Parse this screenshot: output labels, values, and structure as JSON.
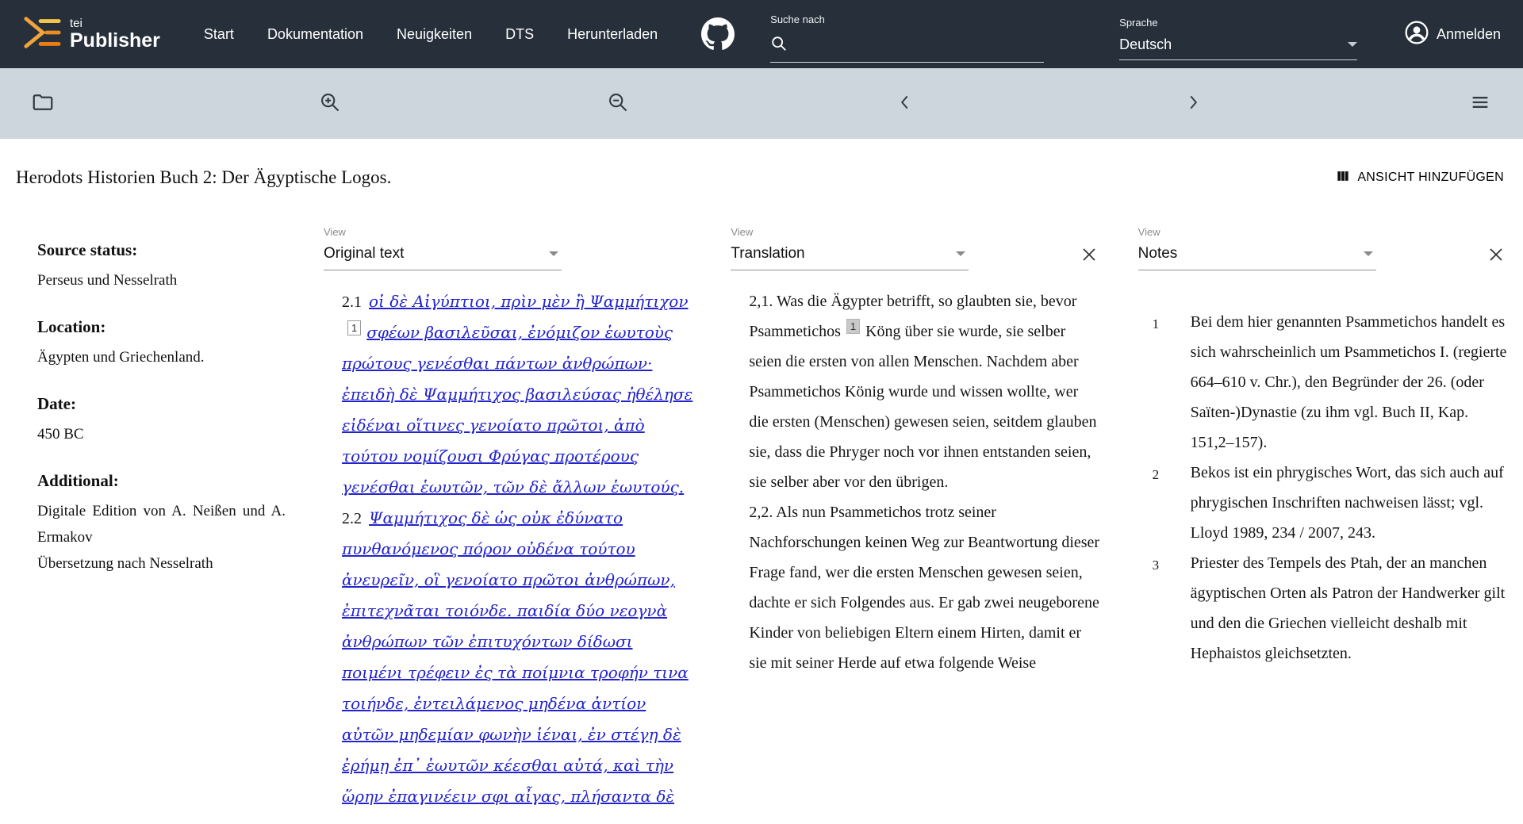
{
  "header": {
    "brand": {
      "top": "tei",
      "bottom": "Publisher"
    },
    "nav": [
      {
        "label": "Start"
      },
      {
        "label": "Dokumentation"
      },
      {
        "label": "Neuigkeiten"
      },
      {
        "label": "DTS"
      },
      {
        "label": "Herunterladen"
      }
    ],
    "search": {
      "label": "Suche nach",
      "value": ""
    },
    "language": {
      "label": "Sprache",
      "value": "Deutsch"
    },
    "login_label": "Anmelden"
  },
  "toolbar": {
    "icons": [
      "folder",
      "zoom-in",
      "zoom-out",
      "chevron-left",
      "chevron-right",
      "menu"
    ]
  },
  "page": {
    "title": "Herodots Historien Buch 2: Der Ägyptische Logos.",
    "add_view_label": "ANSICHT HINZUFÜGEN"
  },
  "metadata": [
    {
      "label": "Source status:",
      "lines": [
        "Perseus und Nesselrath"
      ]
    },
    {
      "label": "Location:",
      "lines": [
        "Ägypten und Griechenland."
      ]
    },
    {
      "label": "Date:",
      "lines": [
        "450 BC"
      ]
    },
    {
      "label": "Additional:",
      "lines": [
        "Digitale Edition von A. Neißen und A. Ermakov",
        "Übersetzung nach Nesselrath"
      ]
    }
  ],
  "panels": [
    {
      "kind": "original",
      "view_label": "View",
      "selected": "Original text",
      "closable": false,
      "paragraphs": [
        {
          "num": "2.1",
          "segments": [
            {
              "type": "link",
              "text": "οἱ δὲ Αἰγύπτιοι, πρὶν μὲν ἢ Ψαμμήτιχον"
            },
            {
              "type": "note-ref",
              "text": "1"
            },
            {
              "type": "link",
              "text": "σφέων βασιλεῦσαι, ἐνόμιζον ἑωυτοὺς πρώτους γενέσθαι πάντων ἀνθρώπων· ἐπειδὴ δὲ Ψαμμήτιχος βασιλεύσας ἠθέλησε εἰδέναι οἵτινες γενοίατο πρῶτοι, ἀπὸ τούτου νομίζουσι Φρύγας προτέρους γενέσθαι ἑωυτῶν, τῶν δὲ ἄλλων ἑωυτούς."
            }
          ]
        },
        {
          "num": "2.2",
          "segments": [
            {
              "type": "link",
              "text": "Ψαμμήτιχος δὲ ὡς οὐκ ἐδύνατο πυνθανόμενος πόρον οὐδένα τούτου ἀνευρεῖν, οἳ γενοίατο πρῶτοι ἀνθρώπων, ἐπιτεχνᾶται τοιόνδε. παιδία δύο νεογνὰ ἀνθρώπων τῶν ἐπιτυχόντων δίδωσι ποιμένι τρέφειν ἐς τὰ ποίμνια τροφήν τινα τοιήνδε, ἐντειλάμενος μηδένα ἀντίον αὐτῶν μηδεμίαν φωνὴν ἱέναι, ἐν στέγῃ δὲ ἐρήμῃ ἐπ᾽ ἑωυτῶν κέεσθαι αὐτά, καὶ τὴν ὥρην ἐπαγινέειν σφι αἶγας, πλήσαντα δὲ"
            }
          ]
        }
      ]
    },
    {
      "kind": "translation",
      "view_label": "View",
      "selected": "Translation",
      "closable": true,
      "paragraphs": [
        {
          "segments": [
            {
              "type": "text",
              "text": "2,1. Was die Ägypter betrifft, so glaubten sie, bevor Psammetichos"
            },
            {
              "type": "note-ref",
              "text": "1"
            },
            {
              "type": "text",
              "text": "Köng über sie wurde, sie selber seien die ersten von allen Menschen. Nachdem aber Psammetichos König wurde und wissen wollte, wer die ersten (Menschen) gewesen seien, seitdem glauben sie, dass die Phryger noch vor ihnen entstanden seien, sie selber aber vor den übrigen."
            }
          ]
        },
        {
          "segments": [
            {
              "type": "text",
              "text": "2,2. Als nun Psammetichos trotz seiner Nachforschungen keinen Weg zur Beantwortung dieser Frage fand, wer die ersten Menschen gewesen seien, dachte er sich Folgendes aus. Er gab zwei neugeborene Kinder von beliebigen Eltern einem Hirten, damit er sie mit seiner Herde auf etwa folgende Weise"
            }
          ]
        }
      ]
    },
    {
      "kind": "notes",
      "view_label": "View",
      "selected": "Notes",
      "closable": true,
      "notes": [
        {
          "num": "1",
          "text": "Bei dem hier genannten Psammetichos handelt es sich wahrscheinlich um Psammetichos I. (regierte 664–610 v. Chr.), den Begründer der 26. (oder Saïten-)Dynastie (zu ihm vgl. Buch II, Kap. 151,2–157)."
        },
        {
          "num": "2",
          "text": "Bekos ist ein phrygisches Wort, das sich auch auf phrygischen Inschriften nachweisen lässt; vgl. Lloyd 1989, 234 / 2007, 243."
        },
        {
          "num": "3",
          "text": "Priester des Tempels des Ptah, der an manchen ägyptischen Orten als Patron der Handwerker gilt und den die Griechen vielleicht deshalb mit Hephaistos gleichsetzten."
        }
      ]
    }
  ],
  "colors": {
    "header_bg": "#262f3a",
    "toolbar_bg": "#ccd6dc",
    "accent_orange": "#f0991e",
    "link_blue": "#2323cc"
  }
}
